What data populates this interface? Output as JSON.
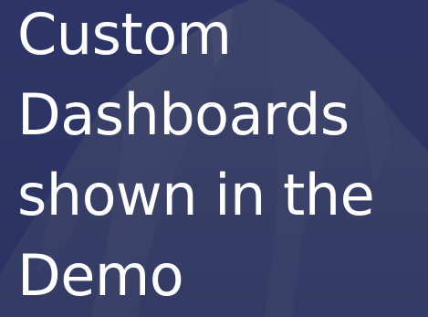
{
  "slide": {
    "title_lines": [
      "Custom",
      "Dashboards",
      "shown in the",
      "Demo"
    ],
    "background": "mountain-photo-with-navy-overlay",
    "colors": {
      "overlay": "#2c3563",
      "text": "#ffffff"
    }
  }
}
